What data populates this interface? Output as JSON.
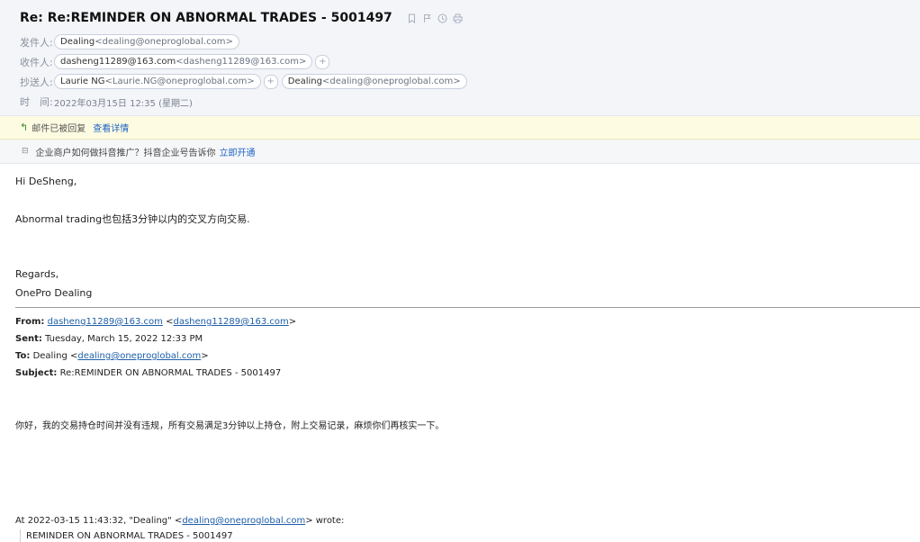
{
  "header": {
    "subject": "Re: Re:REMINDER ON ABNORMAL TRADES - 5001497",
    "icons": [
      "bookmark-icon",
      "flag-icon",
      "clock-icon",
      "print-icon"
    ],
    "from_label": "发件人:",
    "from": {
      "name": "Dealing",
      "addr": "<dealing@oneproglobal.com>"
    },
    "to_label": "收件人:",
    "to": {
      "name": "dasheng11289@163.com",
      "addr": "<dasheng11289@163.com>"
    },
    "cc_label": "抄送人:",
    "cc": [
      {
        "name": "Laurie NG",
        "addr": "<Laurie.NG@oneproglobal.com>"
      },
      {
        "name": "Dealing",
        "addr": "<dealing@oneproglobal.com>"
      }
    ],
    "add_symbol": "+",
    "time_label": "时　间:",
    "time": "2022年03月15日 12:35 (星期二)"
  },
  "notice": {
    "text": "邮件已被回复",
    "link": "查看详情"
  },
  "promo": {
    "text": "企业商户如何做抖音推广？抖音企业号告诉你",
    "link": "立即开通"
  },
  "body": {
    "greeting": "Hi DeSheng,",
    "line1": "Abnormal trading也包括3分钟以内的交叉方向交易.",
    "regards": "Regards,",
    "signature": "OnePro Dealing"
  },
  "quoted": {
    "from_label": "From:",
    "from_link1": "dasheng11289@163.com",
    "from_link2": "dasheng11289@163.com",
    "sent_label": "Sent:",
    "sent": "Tuesday, March 15, 2022 12:33 PM",
    "to_label": "To:",
    "to_name": "Dealing",
    "to_link": "dealing@oneproglobal.com",
    "subject_label": "Subject:",
    "subject": "Re:REMINDER ON ABNORMAL TRADES - 5001497",
    "message": "你好，我的交易持仓时间并没有违规，所有交易满足3分钟以上持仓，附上交易记录，麻烦你们再核实一下。",
    "wrote_prefix": "At 2022-03-15 11:43:32, \"Dealing\" <",
    "wrote_link": "dealing@oneproglobal.com",
    "wrote_suffix": "> wrote:",
    "quote_first": "REMINDER ON ABNORMAL TRADES - 5001497"
  }
}
